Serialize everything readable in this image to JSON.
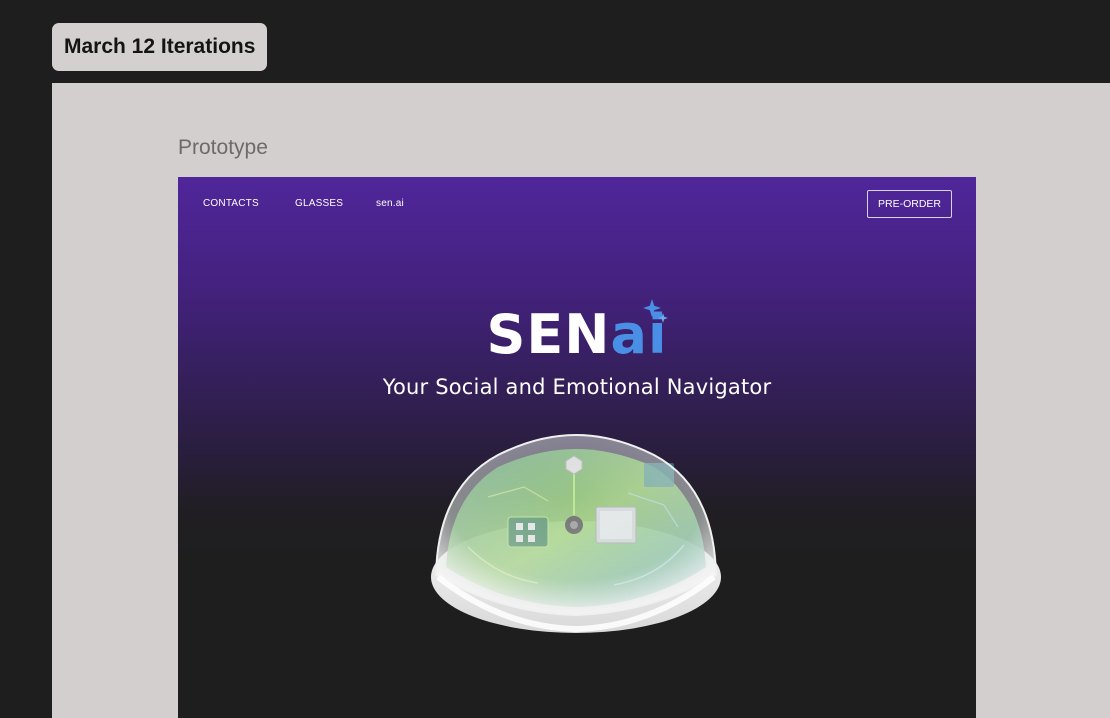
{
  "frame": {
    "title": "March 12 Iterations"
  },
  "section": {
    "label": "Prototype"
  },
  "site": {
    "nav": {
      "links": [
        "CONTACTS",
        "GLASSES",
        "sen.ai"
      ],
      "cta_label": "PRE-ORDER"
    },
    "hero": {
      "logo_main": "SEN",
      "logo_accent": "ai",
      "tagline": "Your Social and Emotional Navigator",
      "image": "dome-device-with-circuit-boards",
      "sparkle_icon": "sparkle-icon"
    },
    "colors": {
      "gradient_top": "#50269a",
      "gradient_bottom": "#1e1e1e",
      "logo_accent": "#4a8fe6",
      "text": "#ffffff"
    }
  }
}
